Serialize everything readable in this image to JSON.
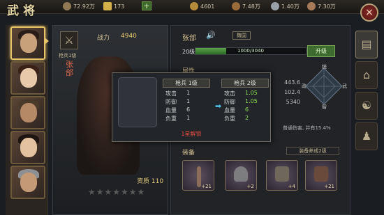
{
  "header": {
    "title": "武将",
    "resources": [
      {
        "name": "copper",
        "value": "72.92万",
        "color": "#8f7a55"
      },
      {
        "name": "gold",
        "value": "173",
        "color": "#d4b04a"
      },
      {
        "name": "grain",
        "value": "4601",
        "color": "#b58b3a"
      },
      {
        "name": "wood",
        "value": "7.48万",
        "color": "#9a6b3a"
      },
      {
        "name": "iron",
        "value": "1.40万",
        "color": "#9aa0a8"
      },
      {
        "name": "stone",
        "value": "7.30万",
        "color": "#a87b5a"
      }
    ],
    "plus_label": "+",
    "close_label": "×"
  },
  "hero": {
    "mode_icon": "crossed-swords-icon",
    "mode_label": "枪兵1级",
    "power_label": "战力",
    "power_value": "4940",
    "name_vertical": "张郃",
    "quality_label": "资质",
    "quality_value": "110",
    "stars": "★★★★★★★"
  },
  "info": {
    "name": "张郃",
    "faction": "魏国",
    "level": "20级",
    "xp_text": "1000/3040",
    "xp_ratio": 0.28,
    "upgrade_label": "升级",
    "attr_label": "属性",
    "attr_values": [
      "443.6",
      "102.4",
      "5340"
    ],
    "radar_labels": [
      "统",
      "武",
      "智",
      "政"
    ],
    "passive_text": "普通伤害, 并有15.4%",
    "equip_label": "装备",
    "equip_link": "装备养成2级",
    "equip_slots": [
      "+21",
      "+2",
      "+4",
      "+21"
    ]
  },
  "modal": {
    "left": {
      "head": "枪兵 1级",
      "stats": [
        {
          "k": "攻击",
          "v": "1"
        },
        {
          "k": "防御",
          "v": "1"
        },
        {
          "k": "血量",
          "v": "6"
        },
        {
          "k": "负重",
          "v": "1"
        }
      ]
    },
    "right": {
      "head": "枪兵 2级",
      "stats": [
        {
          "k": "攻击",
          "v": "1.05"
        },
        {
          "k": "防御",
          "v": "1.05"
        },
        {
          "k": "血量",
          "v": "6"
        },
        {
          "k": "负重",
          "v": "2"
        }
      ]
    },
    "unlock_text": "1星解锁"
  },
  "colors": {
    "accent": "#e5c46a",
    "up_green": "#8ee04f",
    "warn_red": "#e04b3f"
  }
}
